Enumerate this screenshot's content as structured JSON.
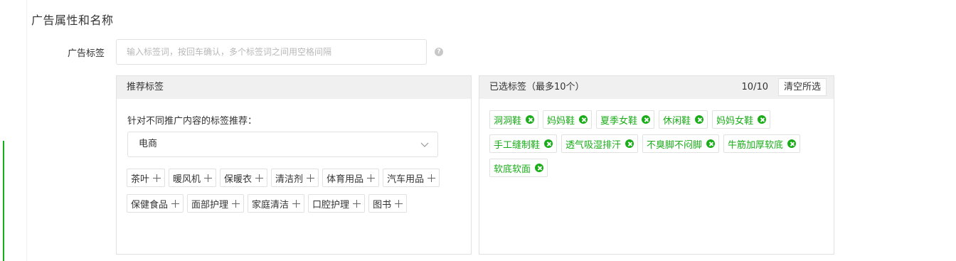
{
  "section": {
    "title": "广告属性和名称"
  },
  "tag_field": {
    "label": "广告标签",
    "value": "",
    "placeholder": "输入标签词，按回车确认，多个标签词之间用空格间隔",
    "help_icon": "question-circle-icon"
  },
  "recommended": {
    "header": "推荐标签",
    "subtitle": "针对不同推广内容的标签推荐：",
    "category_selected": "电商",
    "tags": [
      "茶叶",
      "暖风机",
      "保暖衣",
      "清洁剂",
      "体育用品",
      "汽车用品",
      "保健食品",
      "面部护理",
      "家庭清洁",
      "口腔护理",
      "图书"
    ]
  },
  "selected": {
    "header": "已选标签（最多10个）",
    "count": "10/10",
    "clear_label": "清空所选",
    "tags": [
      "洞洞鞋",
      "妈妈鞋",
      "夏季女鞋",
      "休闲鞋",
      "妈妈女鞋",
      "手工缝制鞋",
      "透气吸湿排汗",
      "不臭脚不闷脚",
      "牛筋加厚软底",
      "软底软面"
    ]
  },
  "colors": {
    "accent": "#1aad19",
    "border": "#e1e1e1",
    "header_bg": "#f0f0f0"
  }
}
